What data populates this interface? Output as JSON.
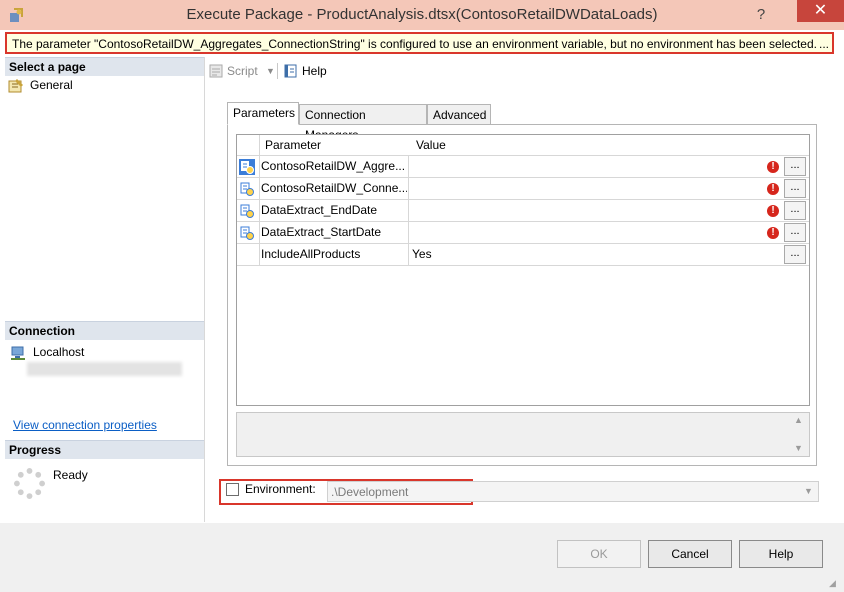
{
  "window": {
    "title": "Execute Package - ProductAnalysis.dtsx(ContosoRetailDWDataLoads)",
    "help_glyph": "?",
    "close_glyph": "✕"
  },
  "warning": {
    "message": "The parameter \"ContosoRetailDW_Aggregates_ConnectionString\" is configured to use an environment variable, but no environment has been selected.",
    "more": "..."
  },
  "left": {
    "select_page_label": "Select a page",
    "pages": [
      {
        "label": "General"
      }
    ],
    "connection_label": "Connection",
    "server": "Localhost",
    "view_connection_link": "View connection properties",
    "progress_label": "Progress",
    "progress_status": "Ready"
  },
  "toolbar": {
    "script_label": "Script",
    "help_label": "Help"
  },
  "tabs": [
    {
      "label": "Parameters"
    },
    {
      "label": "Connection Managers"
    },
    {
      "label": "Advanced"
    }
  ],
  "grid": {
    "headers": [
      "Parameter",
      "Value"
    ],
    "rows": [
      {
        "name": "ContosoRetailDW_Aggre...",
        "value": "",
        "error": true
      },
      {
        "name": "ContosoRetailDW_Conne...",
        "value": "",
        "error": true
      },
      {
        "name": "DataExtract_EndDate",
        "value": "",
        "error": true
      },
      {
        "name": "DataExtract_StartDate",
        "value": "",
        "error": true
      },
      {
        "name": "IncludeAllProducts",
        "value": "Yes",
        "error": false
      }
    ],
    "ellipsis": "..."
  },
  "environment": {
    "label": "Environment:",
    "value": ".\\Development",
    "checked": false
  },
  "buttons": {
    "ok": "OK",
    "cancel": "Cancel",
    "help": "Help"
  },
  "colors": {
    "title_bg": "#f4c7b8",
    "close_bg": "#c7453c",
    "highlight": "#d9362b",
    "link": "#0b5ec5",
    "error": "#d6261c"
  }
}
